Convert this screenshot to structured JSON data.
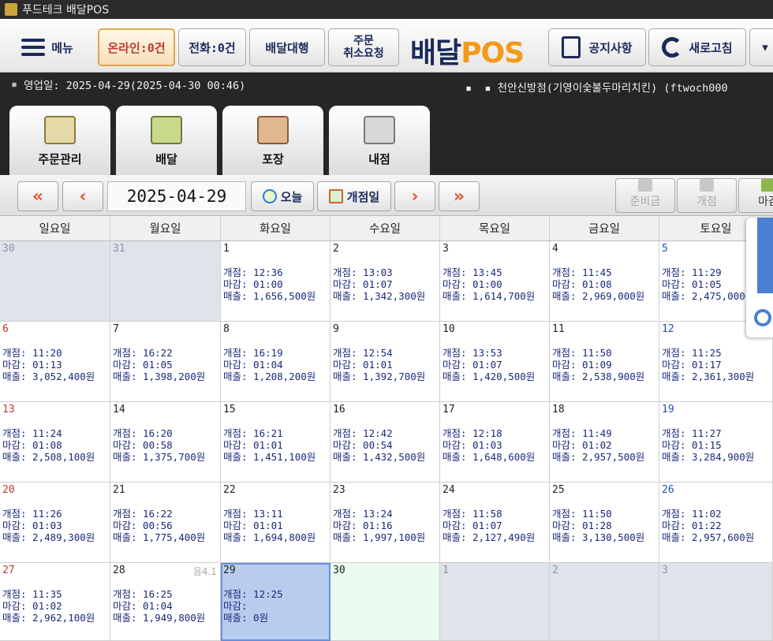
{
  "window": {
    "title": "푸드테크 배달POS"
  },
  "toolbar": {
    "menu_label": "메뉴",
    "online_label": "온라인:0건",
    "phone_label": "전화:0건",
    "delivery_agent_label": "배달대행",
    "cancel_request_label_1": "주문",
    "cancel_request_label_2": "취소요청",
    "brand_main": "배달",
    "brand_accent": "POS",
    "notice_label": "공지사항",
    "refresh_label": "새로고침",
    "more_label": "▾"
  },
  "infobar": {
    "business_day": "영업일: 2025-04-29(2025-04-30 00:46)",
    "store": "천안신방점(기영이숯불두마리치킨) (ftwoch000"
  },
  "tabs": [
    {
      "label": "주문관리",
      "icon": "clipboard-icon"
    },
    {
      "label": "배달",
      "icon": "truck-icon"
    },
    {
      "label": "포장",
      "icon": "basket-icon"
    },
    {
      "label": "내점",
      "icon": "fork-spoon-icon"
    }
  ],
  "nav": {
    "date": "2025-04-29",
    "today_label": "오늘",
    "open_day_label": "개점일",
    "reserve_label": "준비금",
    "open_label": "개점",
    "close_label": "마감"
  },
  "weekdays": [
    "일요일",
    "월요일",
    "화요일",
    "수요일",
    "목요일",
    "금요일",
    "토요일"
  ],
  "cells": [
    {
      "day": "30",
      "other": true
    },
    {
      "day": "31",
      "other": true
    },
    {
      "day": "1",
      "info": "개점: 12:36\n마감: 01:00\n매출: 1,656,500원"
    },
    {
      "day": "2",
      "info": "개점: 13:03\n마감: 01:07\n매출: 1,342,300원"
    },
    {
      "day": "3",
      "info": "개점: 13:45\n마감: 01:00\n매출: 1,614,700원"
    },
    {
      "day": "4",
      "info": "개점: 11:45\n마감: 01:08\n매출: 2,969,000원"
    },
    {
      "day": "5",
      "info": "개점: 11:29\n마감: 01:05\n매출: 2,475,000원"
    },
    {
      "day": "6",
      "info": "개점: 11:20\n마감: 01:13\n매출: 3,052,400원"
    },
    {
      "day": "7",
      "info": "개점: 16:22\n마감: 01:05\n매출: 1,398,200원"
    },
    {
      "day": "8",
      "info": "개점: 16:19\n마감: 01:04\n매출: 1,208,200원"
    },
    {
      "day": "9",
      "info": "개점: 12:54\n마감: 01:01\n매출: 1,392,700원"
    },
    {
      "day": "10",
      "info": "개점: 13:53\n마감: 01:07\n매출: 1,420,500원"
    },
    {
      "day": "11",
      "info": "개점: 11:50\n마감: 01:09\n매출: 2,538,900원"
    },
    {
      "day": "12",
      "lunar": "음",
      "info": "개점: 11:25\n마감: 01:17\n매출: 2,361,300원"
    },
    {
      "day": "13",
      "info": "개점: 11:24\n마감: 01:08\n매출: 2,508,100원"
    },
    {
      "day": "14",
      "info": "개점: 16:20\n마감: 00:58\n매출: 1,375,700원"
    },
    {
      "day": "15",
      "info": "개점: 16:21\n마감: 01:01\n매출: 1,451,100원"
    },
    {
      "day": "16",
      "info": "개점: 12:42\n마감: 00:54\n매출: 1,432,500원"
    },
    {
      "day": "17",
      "info": "개점: 12:18\n마감: 01:03\n매출: 1,648,600원"
    },
    {
      "day": "18",
      "info": "개점: 11:49\n마감: 01:02\n매출: 2,957,500원"
    },
    {
      "day": "19",
      "info": "개점: 11:27\n마감: 01:15\n매출: 3,284,900원"
    },
    {
      "day": "20",
      "info": "개점: 11:26\n마감: 01:03\n매출: 2,489,300원"
    },
    {
      "day": "21",
      "info": "개점: 16:22\n마감: 00:56\n매출: 1,775,400원"
    },
    {
      "day": "22",
      "info": "개점: 13:11\n마감: 01:01\n매출: 1,694,800원"
    },
    {
      "day": "23",
      "info": "개점: 13:24\n마감: 01:16\n매출: 1,997,100원"
    },
    {
      "day": "24",
      "info": "개점: 11:58\n마감: 01:07\n매출: 2,127,490원"
    },
    {
      "day": "25",
      "info": "개점: 11:50\n마감: 01:28\n매출: 3,130,500원"
    },
    {
      "day": "26",
      "info": "개점: 11:02\n마감: 01:22\n매출: 2,957,600원"
    },
    {
      "day": "27",
      "info": "개점: 11:35\n마감: 01:02\n매출: 2,962,100원"
    },
    {
      "day": "28",
      "lunar": "음4.1",
      "info": "개점: 16:25\n마감: 01:04\n매출: 1,949,800원"
    },
    {
      "day": "29",
      "today": true,
      "info": "개점: 12:25\n마감:\n매출: 0원"
    },
    {
      "day": "30",
      "future": true
    },
    {
      "day": "1",
      "other": true
    },
    {
      "day": "2",
      "other": true
    },
    {
      "day": "3",
      "other": true
    }
  ],
  "colors": {
    "accent": "#f39a1a",
    "navy": "#1a2a5a",
    "arrow": "#e8552a",
    "today": "#b8cdee",
    "sunday": "#c0392b",
    "saturday": "#1f4fbf"
  }
}
